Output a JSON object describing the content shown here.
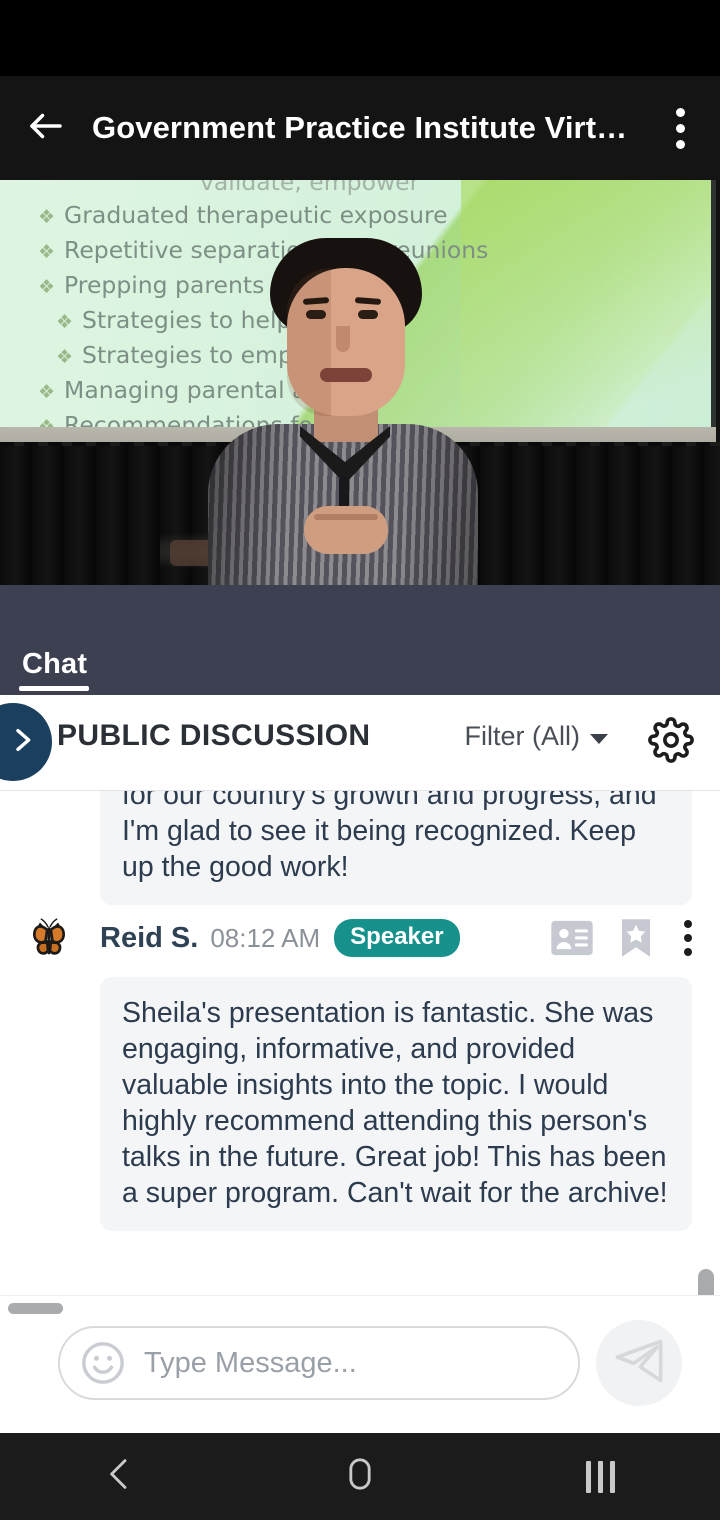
{
  "app_bar": {
    "back_icon": "arrow-left-icon",
    "title": "Government Practice Institute Virt…",
    "overflow_icon": "more-vertical-icon"
  },
  "video": {
    "slide_lines": [
      {
        "text": "validate, empower",
        "indent": 1,
        "clipped": true,
        "bullet": false
      },
      {
        "text": "Graduated therapeutic exposure",
        "indent": 0,
        "clipped": false,
        "bullet": true
      },
      {
        "text": "Repetitive separations and reunions",
        "indent": 0,
        "clipped": false,
        "bullet": true
      },
      {
        "text": "Prepping parents and chi",
        "indent": 0,
        "clipped": false,
        "bullet": true
      },
      {
        "text": "Strategies to help pare",
        "indent": 1,
        "clipped": false,
        "bullet": true
      },
      {
        "text": "Strategies to empower",
        "indent": 1,
        "clipped": false,
        "bullet": true
      },
      {
        "text": "Managing parental anxiet",
        "indent": 0,
        "clipped": false,
        "bullet": true
      },
      {
        "text": "Recommendations fo",
        "indent": 0,
        "clipped": false,
        "bullet": true
      }
    ]
  },
  "chat_tabs": {
    "active_tab": "Chat"
  },
  "discussion": {
    "expand_icon": "chevron-right-icon",
    "title": "PUBLIC DISCUSSION",
    "filter_label": "Filter (All)",
    "filter_caret_icon": "caret-down-icon",
    "settings_icon": "gear-icon"
  },
  "messages": {
    "previous_message_partial": "for our country's growth and progress, and I'm glad to see it being recognized. Keep up the good work!",
    "items": [
      {
        "avatar_icon": "butterfly-avatar",
        "author": "Reid S.",
        "time": "08:12 AM",
        "badge": "Speaker",
        "actions": [
          "contact-card-icon",
          "bookmark-star-icon",
          "more-vertical-icon"
        ],
        "text": "Sheila's presentation is fantastic. She was engaging, informative, and provided valuable insights into the topic. I would highly recommend attending this person's talks in the future. Great job! This has been a super program. Can't wait for the archive!"
      }
    ]
  },
  "composer": {
    "emoji_icon": "emoji-smiley-icon",
    "placeholder": "Type Message...",
    "send_icon": "send-paper-plane-icon"
  },
  "navbar": {
    "back_icon": "nav-back-icon",
    "home_icon": "nav-home-icon",
    "recents_icon": "nav-recents-icon"
  },
  "colors": {
    "status_bar": "#000000",
    "app_bar": "#141414",
    "chat_tab_bar": "#3c4050",
    "expand_button": "#1b3f5e",
    "speaker_badge": "#17918b",
    "bubble": "#f4f5f7",
    "bubble_text": "#2d3b4e",
    "nav_bar": "#1b1b1b"
  }
}
